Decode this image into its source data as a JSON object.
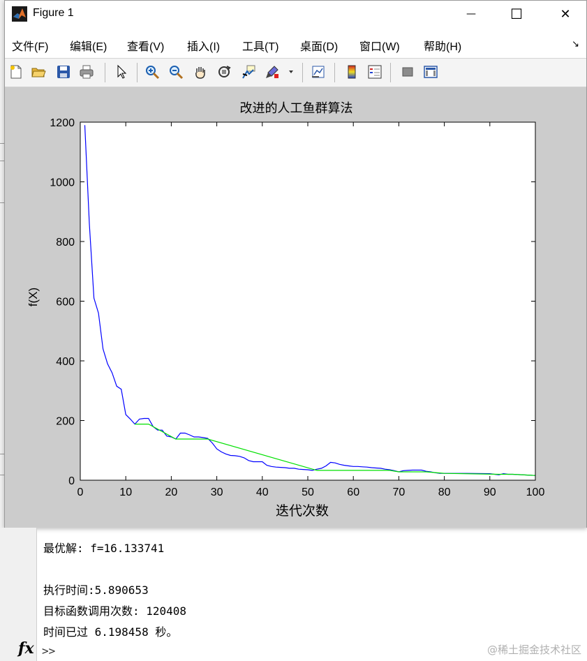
{
  "window": {
    "title": "Figure 1",
    "minimize_glyph": "—",
    "maximize_glyph": "☐",
    "close_glyph": "✕"
  },
  "menu": {
    "items": [
      "文件(F)",
      "编辑(E)",
      "查看(V)",
      "插入(I)",
      "工具(T)",
      "桌面(D)",
      "窗口(W)",
      "帮助(H)"
    ],
    "overflow_glyph": "↘"
  },
  "toolbar": {
    "icons": [
      "new-figure-icon",
      "open-file-icon",
      "save-icon",
      "print-icon",
      "pointer-icon",
      "zoom-in-icon",
      "zoom-out-icon",
      "pan-icon",
      "rotate-3d-icon",
      "data-cursor-icon",
      "brush-icon",
      "link-plot-icon",
      "colorbar-icon",
      "legend-icon",
      "hide-plot-tools-icon",
      "show-plot-tools-icon"
    ]
  },
  "chart_data": {
    "type": "line",
    "title": "改进的人工鱼群算法",
    "xlabel": "迭代次数",
    "ylabel": "f(X)",
    "xlim": [
      0,
      100
    ],
    "ylim": [
      0,
      1200
    ],
    "xticks": [
      0,
      10,
      20,
      30,
      40,
      50,
      60,
      70,
      80,
      90,
      100
    ],
    "yticks": [
      0,
      200,
      400,
      600,
      800,
      1000,
      1200
    ],
    "grid": false,
    "series": [
      {
        "color": "#0000ff",
        "x": [
          1,
          2,
          3,
          4,
          5,
          6,
          7,
          8,
          9,
          10,
          11,
          12,
          13,
          14,
          15,
          16,
          17,
          18,
          19,
          20,
          21,
          22,
          23,
          24,
          25,
          26,
          27,
          28,
          29,
          30,
          31,
          32,
          33,
          34,
          35,
          36,
          37,
          38,
          39,
          40,
          41,
          42,
          43,
          44,
          45,
          46,
          47,
          48,
          49,
          50,
          51,
          52,
          53,
          54,
          55,
          56,
          57,
          58,
          59,
          60,
          61,
          62,
          63,
          64,
          65,
          66,
          67,
          68,
          69,
          70,
          71,
          72,
          73,
          74,
          75,
          76,
          77,
          78,
          79,
          80,
          85,
          90,
          91,
          92,
          93,
          94,
          95,
          100
        ],
        "values": [
          1190,
          860,
          610,
          560,
          440,
          390,
          360,
          315,
          305,
          220,
          205,
          188,
          205,
          207,
          207,
          180,
          168,
          168,
          148,
          145,
          138,
          158,
          158,
          152,
          145,
          145,
          143,
          140,
          125,
          105,
          95,
          88,
          83,
          82,
          80,
          75,
          66,
          62,
          62,
          62,
          50,
          46,
          44,
          43,
          42,
          40,
          40,
          37,
          36,
          35,
          33,
          37,
          40,
          48,
          60,
          58,
          53,
          50,
          48,
          46,
          46,
          45,
          44,
          42,
          41,
          40,
          37,
          35,
          32,
          28,
          32,
          33,
          34,
          34,
          34,
          30,
          28,
          25,
          23,
          23,
          23,
          22,
          20,
          18,
          22,
          20,
          20,
          16
        ]
      },
      {
        "color": "#00e000",
        "x": [
          12,
          15,
          21,
          28,
          52,
          68,
          70,
          76,
          80,
          92,
          95,
          100
        ],
        "values": [
          188,
          188,
          138,
          138,
          33,
          33,
          28,
          28,
          23,
          20,
          20,
          16
        ]
      }
    ]
  },
  "command_window": {
    "lines": [
      "最优解: f=16.133741",
      "",
      "执行时间:5.890653",
      "目标函数调用次数: 120408",
      "时间已过 6.198458 秒。"
    ],
    "fx_label": "fx",
    "prompt": ">>"
  },
  "watermark": "@稀土掘金技术社区"
}
